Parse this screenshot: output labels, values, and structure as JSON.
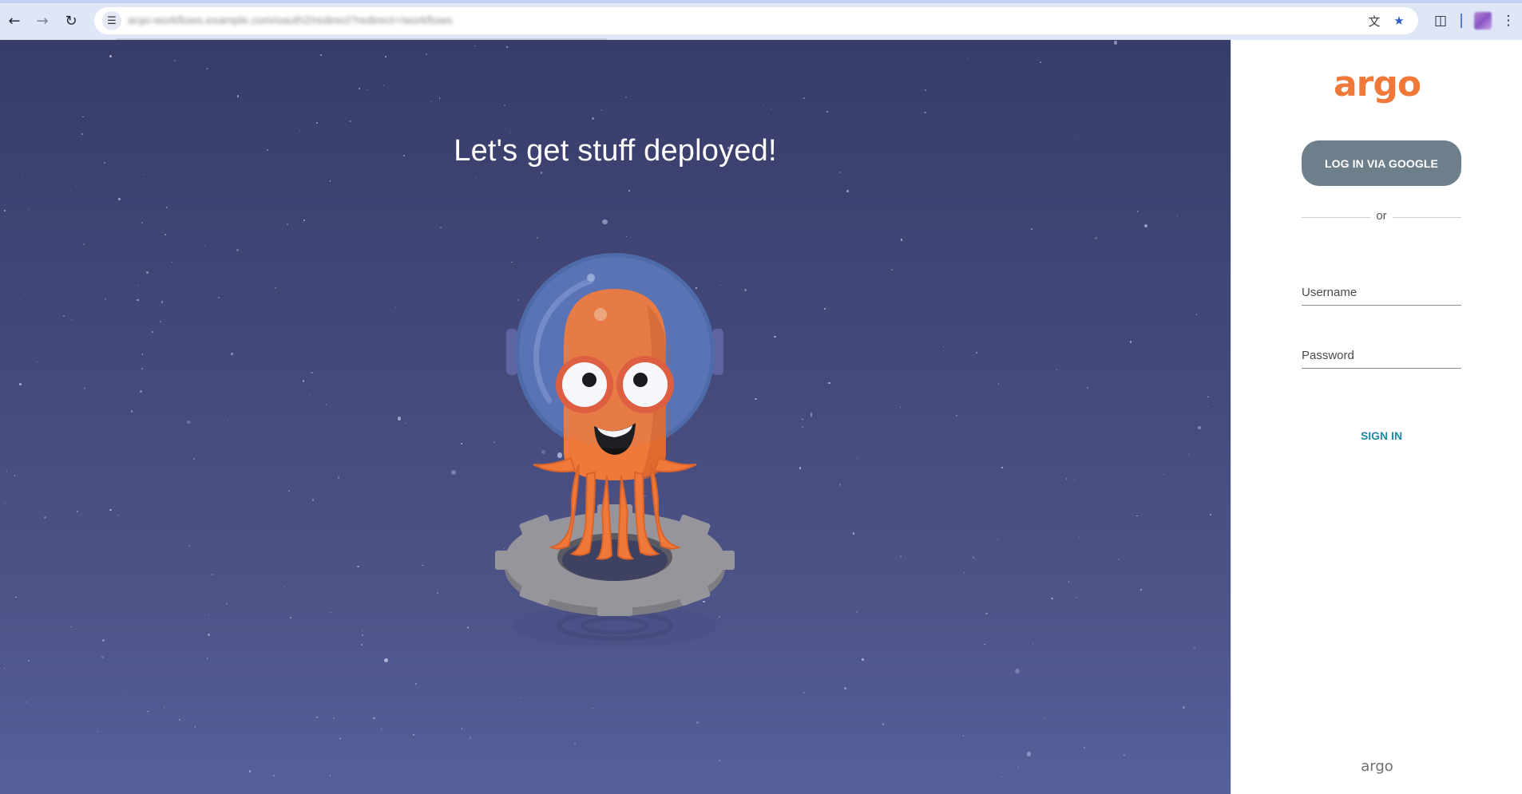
{
  "browser": {
    "back_icon": "arrow-left-icon",
    "forward_icon": "arrow-right-icon",
    "reload_icon": "reload-icon",
    "url": "argo-workflows.example.com/oauth2/redirect?redirect=/workflows",
    "site_info_icon": "tune-icon",
    "translate_icon": "translate-icon",
    "bookmark_icon": "star-icon",
    "extensions_icon": "puzzle-icon",
    "menu_icon": "kebab-menu-icon"
  },
  "hero": {
    "title": "Let's get stuff deployed!",
    "mascot_icon": "octopus-astronaut-icon"
  },
  "login": {
    "logo_text": "argo",
    "google_button_label": "LOG IN VIA GOOGLE",
    "divider_text": "or",
    "username_label": "Username",
    "password_label": "Password",
    "signin_label": "SIGN IN",
    "footer_logo_text": "argo"
  },
  "colors": {
    "brand_orange": "#f0793a",
    "google_button_bg": "#6d7f8b",
    "signin_teal": "#1f8aa8",
    "hero_bg_top": "#383c68",
    "hero_bg_bottom": "#55609a"
  }
}
